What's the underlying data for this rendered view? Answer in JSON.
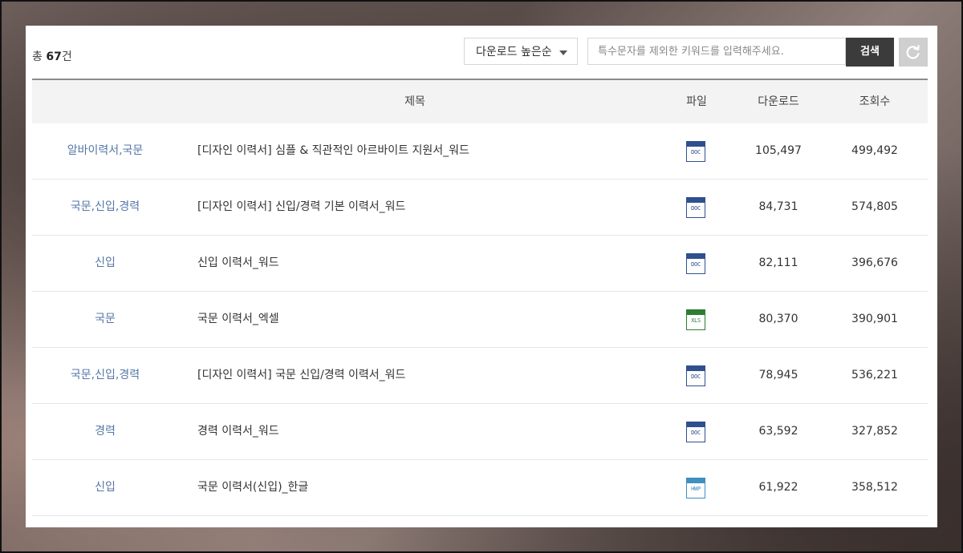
{
  "toolbar": {
    "total_prefix": "총 ",
    "total_count": "67",
    "total_suffix": "건",
    "sort_label": "다운로드 높은순",
    "search_placeholder": "특수문자를 제외한 키워드를 입력해주세요.",
    "search_label": "검색"
  },
  "table": {
    "headers": {
      "title": "제목",
      "file": "파일",
      "downloads": "다운로드",
      "views": "조회수"
    },
    "rows": [
      {
        "category": "알바이력서,국문",
        "title": "[디자인 이력서] 심플 & 직관적인 아르바이트 지원서_워드",
        "file_type": "DOC",
        "downloads": "105,497",
        "views": "499,492"
      },
      {
        "category": "국문,신입,경력",
        "title": "[디자인 이력서] 신입/경력 기본 이력서_워드",
        "file_type": "DOC",
        "downloads": "84,731",
        "views": "574,805"
      },
      {
        "category": "신입",
        "title": "신입 이력서_워드",
        "file_type": "DOC",
        "downloads": "82,111",
        "views": "396,676"
      },
      {
        "category": "국문",
        "title": "국문 이력서_엑셀",
        "file_type": "XLS",
        "downloads": "80,370",
        "views": "390,901"
      },
      {
        "category": "국문,신입,경력",
        "title": "[디자인 이력서] 국문 신입/경력 이력서_워드",
        "file_type": "DOC",
        "downloads": "78,945",
        "views": "536,221"
      },
      {
        "category": "경력",
        "title": "경력 이력서_워드",
        "file_type": "DOC",
        "downloads": "63,592",
        "views": "327,852"
      },
      {
        "category": "신입",
        "title": "국문 이력서(신입)_한글",
        "file_type": "HWP",
        "downloads": "61,922",
        "views": "358,512"
      }
    ]
  },
  "colors": {
    "category_link": "#5577a8",
    "doc_icon": "#2f4f8f",
    "xls_icon": "#2e7d32",
    "hwp_icon": "#3f8fbf",
    "search_button": "#3b3b3b",
    "reset_button": "#cfcfcf"
  }
}
